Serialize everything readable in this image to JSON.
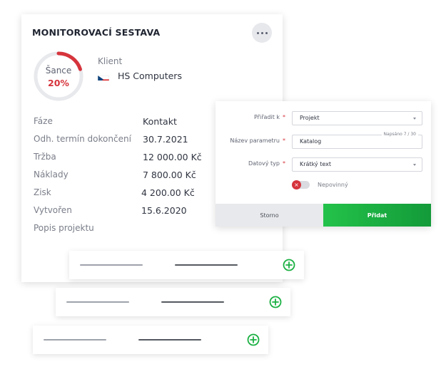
{
  "card": {
    "title": "MONITOROVACÍ SESTAVA",
    "chance_label": "Šance",
    "chance_value": "20%",
    "chance_fraction": 0.2,
    "client_label": "Klient",
    "client_name": "HS Computers",
    "rows": [
      {
        "label": "Fáze",
        "value": "Kontakt"
      },
      {
        "label": "Odh. termín dokončení",
        "value": "30.7.2021"
      },
      {
        "label": "Tržba",
        "value": "12 000.00 Kč"
      },
      {
        "label": "Náklady",
        "value": "7 800.00 Kč"
      },
      {
        "label": "Zisk",
        "value": "4 200.00 Kč"
      },
      {
        "label": "Vytvořen",
        "value": "15.6.2020"
      },
      {
        "label": "Popis projektu",
        "value": ""
      }
    ]
  },
  "dialog": {
    "assign_label": "Přiřadit k",
    "assign_value": "Projekt",
    "param_label": "Název parametru",
    "param_value": "Katalog",
    "counter": "Napsáno 7 / 30",
    "type_label": "Datový typ",
    "type_value": "Krátký text",
    "toggle_label": "Nepovinný",
    "required_mark": "*",
    "cancel_label": "Storno",
    "add_label": "Přidat"
  },
  "colors": {
    "accent_red": "#d6343c",
    "accent_green": "#1bb043",
    "gauge_track": "#e8e9ec"
  },
  "icons": {
    "more": "more-horizontal-icon",
    "flag": "czech-flag-icon",
    "toggle_off": "close-icon",
    "add": "plus-circle-icon"
  }
}
